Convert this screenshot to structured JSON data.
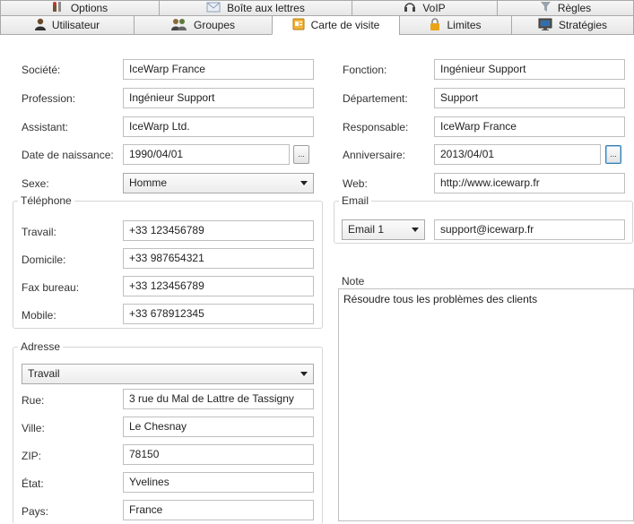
{
  "tabs_row1": [
    {
      "label": "Options",
      "icon": "options-icon"
    },
    {
      "label": "Boîte aux lettres",
      "icon": "mailbox-icon"
    },
    {
      "label": "VoIP",
      "icon": "voip-headset-icon"
    },
    {
      "label": "Règles",
      "icon": "filter-rules-icon"
    }
  ],
  "tabs_row2": [
    {
      "label": "Utilisateur",
      "icon": "user-icon"
    },
    {
      "label": "Groupes",
      "icon": "groups-icon"
    },
    {
      "label": "Carte de visite",
      "icon": "business-card-icon"
    },
    {
      "label": "Limites",
      "icon": "lock-icon"
    },
    {
      "label": "Stratégies",
      "icon": "policy-monitor-icon"
    }
  ],
  "left": {
    "societe_label": "Société:",
    "societe": "IceWarp France",
    "profession_label": "Profession:",
    "profession": "Ingénieur Support",
    "assistant_label": "Assistant:",
    "assistant": "IceWarp Ltd.",
    "naissance_label": "Date de naissance:",
    "naissance": "1990/04/01",
    "sexe_label": "Sexe:",
    "sexe": "Homme"
  },
  "telephone": {
    "title": "Téléphone",
    "travail_label": "Travail:",
    "travail": "+33 123456789",
    "domicile_label": "Domicile:",
    "domicile": "+33 987654321",
    "fax_label": "Fax bureau:",
    "fax": "+33 123456789",
    "mobile_label": "Mobile:",
    "mobile": "+33 678912345"
  },
  "adresse": {
    "title": "Adresse",
    "type": "Travail",
    "rue_label": "Rue:",
    "rue": "3 rue du Mal de Lattre de Tassigny",
    "ville_label": "Ville:",
    "ville": "Le Chesnay",
    "zip_label": "ZIP:",
    "zip": "78150",
    "etat_label": "État:",
    "etat": "Yvelines",
    "pays_label": "Pays:",
    "pays": "France"
  },
  "right": {
    "fonction_label": "Fonction:",
    "fonction": "Ingénieur Support",
    "departement_label": "Département:",
    "departement": "Support",
    "responsable_label": "Responsable:",
    "responsable": "IceWarp France",
    "anniversaire_label": "Anniversaire:",
    "anniversaire": "2013/04/01",
    "web_label": "Web:",
    "web": "http://www.icewarp.fr"
  },
  "email": {
    "title": "Email",
    "type": "Email 1",
    "address": "support@icewarp.fr"
  },
  "note": {
    "title": "Note",
    "text": "Résoudre tous les problèmes des clients"
  },
  "dots_label": "..."
}
